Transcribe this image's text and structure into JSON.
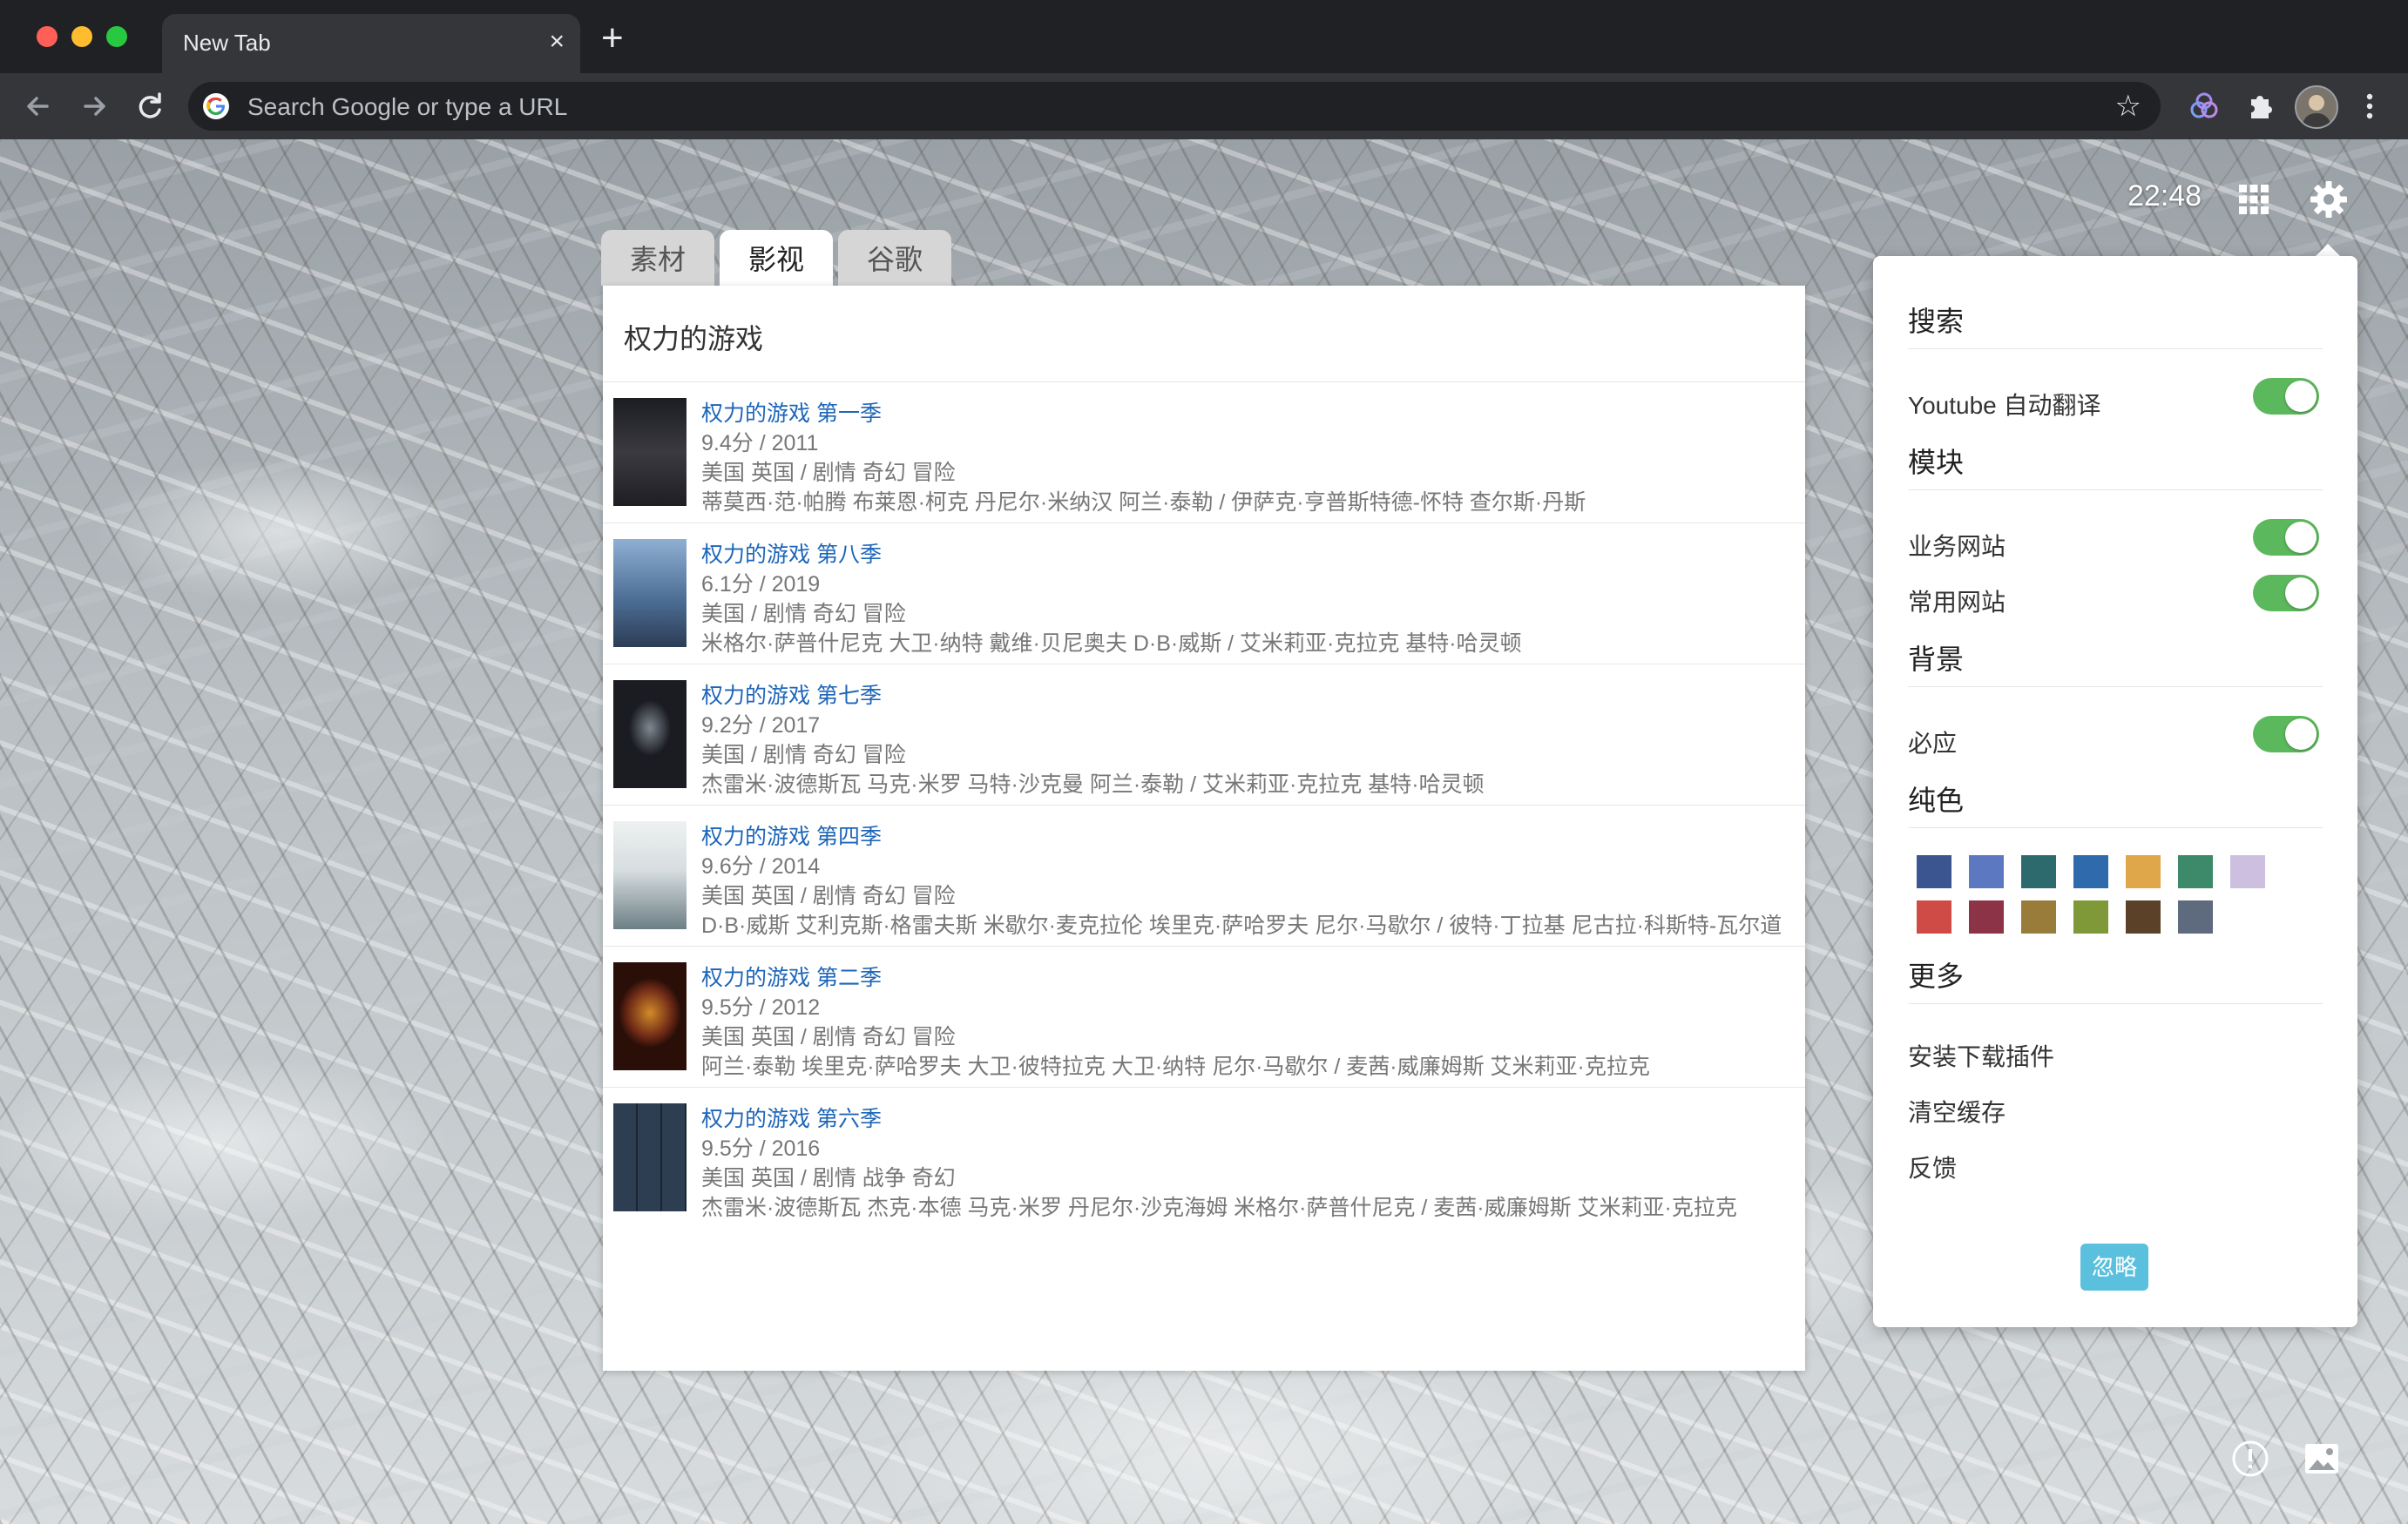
{
  "browser": {
    "tab_title": "New Tab",
    "tab_close": "×",
    "new_tab": "+",
    "omnibox_placeholder": "Search Google or type a URL"
  },
  "page": {
    "clock": "22:48",
    "widget": {
      "tabs": [
        "素材",
        "影视",
        "谷歌"
      ],
      "active_tab": "影视",
      "query": "权力的游戏",
      "results": [
        {
          "title": "权力的游戏 第一季",
          "rating": "9.4分 / 2011",
          "meta": "美国 英国 / 剧情 奇幻 冒险",
          "cast": "蒂莫西·范·帕腾 布莱恩·柯克 丹尼尔·米纳汉 阿兰·泰勒 / 伊萨克·亨普斯特德-怀特 查尔斯·丹斯",
          "poster_color": "#2b2c30"
        },
        {
          "title": "权力的游戏 第八季",
          "rating": "6.1分 / 2019",
          "meta": "美国 / 剧情 奇幻 冒险",
          "cast": "米格尔·萨普什尼克 大卫·纳特 戴维·贝尼奥夫 D·B·威斯 / 艾米莉亚·克拉克 基特·哈灵顿",
          "poster_color": "#5b7da6"
        },
        {
          "title": "权力的游戏 第七季",
          "rating": "9.2分 / 2017",
          "meta": "美国 / 剧情 奇幻 冒险",
          "cast": "杰雷米·波德斯瓦 马克·米罗 马特·沙克曼 阿兰·泰勒 / 艾米莉亚·克拉克 基特·哈灵顿",
          "poster_color": "#1a1c22"
        },
        {
          "title": "权力的游戏 第四季",
          "rating": "9.6分 / 2014",
          "meta": "美国 英国 / 剧情 奇幻 冒险",
          "cast": "D·B·威斯 艾利克斯·格雷夫斯 米歇尔·麦克拉伦 埃里克·萨哈罗夫 尼尔·马歇尔 / 彼特·丁拉基 尼古拉·科斯特-瓦尔道",
          "poster_color": "#d8dedf"
        },
        {
          "title": "权力的游戏 第二季",
          "rating": "9.5分 / 2012",
          "meta": "美国 英国 / 剧情 奇幻 冒险",
          "cast": "阿兰·泰勒 埃里克·萨哈罗夫 大卫·彼特拉克 大卫·纳特 尼尔·马歇尔 / 麦茜·威廉姆斯 艾米莉亚·克拉克",
          "poster_color": "#6e2a16"
        },
        {
          "title": "权力的游戏 第六季",
          "rating": "9.5分 / 2016",
          "meta": "美国 英国 / 剧情 战争 奇幻",
          "cast": "杰雷米·波德斯瓦 杰克·本德 马克·米罗 丹尼尔·沙克海姆 米格尔·萨普什尼克 / 麦茜·威廉姆斯 艾米莉亚·克拉克",
          "poster_color": "#2e3e52"
        }
      ]
    },
    "settings": {
      "search": {
        "heading": "搜索",
        "youtube_translate": "Youtube 自动翻译"
      },
      "modules": {
        "heading": "模块",
        "business_sites": "业务网站",
        "common_sites": "常用网站"
      },
      "background": {
        "heading": "背景",
        "bing": "必应"
      },
      "solid": {
        "heading": "纯色",
        "colors_row1": [
          "#3a5590",
          "#5b78c0",
          "#2d6a6e",
          "#2f6aad",
          "#e0a64a",
          "#3c8a6a",
          "#cdbfe0"
        ],
        "colors_row2": [
          "#cf4c46",
          "#8c3348",
          "#9a7c3a",
          "#7f9838",
          "#5b4127",
          "#5e6a7d"
        ]
      },
      "more": {
        "heading": "更多",
        "install_plugin": "安装下载插件",
        "clear_cache": "清空缓存",
        "feedback": "反馈"
      },
      "ignore_button": "忽略"
    }
  }
}
